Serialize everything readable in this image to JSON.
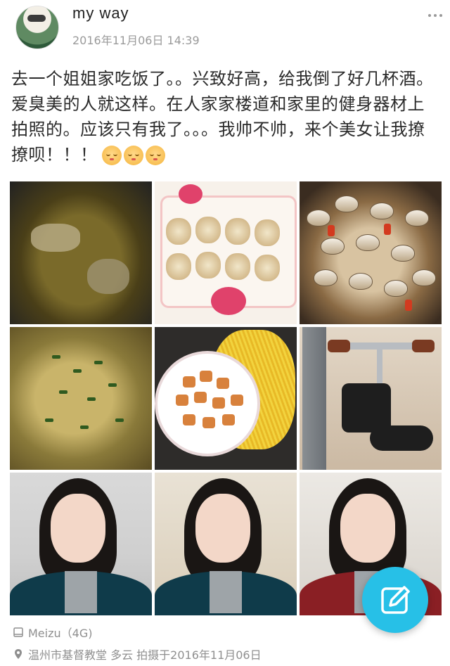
{
  "post": {
    "username": "my  way",
    "timestamp": "2016年11月06日  14:39",
    "text": "去一个姐姐家吃饭了。。兴致好高，给我倒了好几杯酒。爱臭美的人就这样。在人家家楼道和家里的健身器材上拍照的。应该只有我了。。。我帅不帅，来个美女让我撩撩呗！！！",
    "emojis": [
      "shy-smile-emoji",
      "shy-smile-emoji",
      "shy-smile-emoji"
    ],
    "photos": [
      {
        "subject": "soup-with-meat"
      },
      {
        "subject": "sticky-rice-balls-on-plate"
      },
      {
        "subject": "stir-fried-clams"
      },
      {
        "subject": "greens-and-fish-stew"
      },
      {
        "subject": "braised-pork-and-shredded-potato"
      },
      {
        "subject": "fitness-equipment"
      },
      {
        "subject": "selfie"
      },
      {
        "subject": "selfie"
      },
      {
        "subject": "selfie"
      }
    ]
  },
  "footer": {
    "device": "Meizu（4G)",
    "location": "温州市基督教堂  多云  拍摄于2016年11月06日"
  },
  "icons": {
    "more": "more-dots-icon",
    "compose": "edit-pencil-icon",
    "device": "phone-icon",
    "location": "location-pin-icon"
  },
  "colors": {
    "fab": "#27c0e7",
    "meta_text": "#8f8f8f",
    "body_text": "#2b2b2b"
  }
}
